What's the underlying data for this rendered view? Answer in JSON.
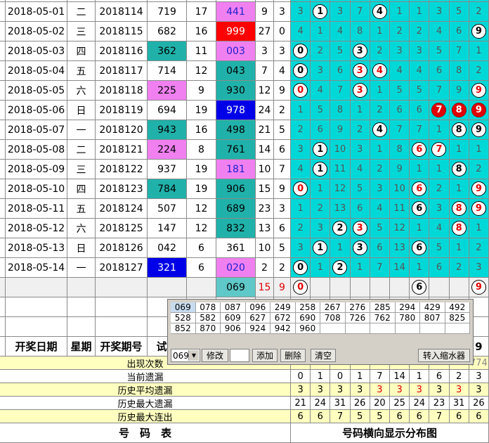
{
  "headers": {
    "date": "开奖日期",
    "weekday": "星期",
    "issue": "开奖期号",
    "number": "试机",
    "last_col_digit": "9"
  },
  "rows": [
    {
      "date": "2018-05-01",
      "weekday": "二",
      "issue": "2018114",
      "trial": "719",
      "c5": "17",
      "prize": "441",
      "sum": "9",
      "span": "3",
      "dist": [
        "3",
        "1",
        "3",
        "7",
        "4",
        "1",
        "1",
        "3",
        "5",
        "2"
      ],
      "balls": [
        1,
        4
      ]
    },
    {
      "date": "2018-05-02",
      "weekday": "三",
      "issue": "2018115",
      "trial": "682",
      "c5": "16",
      "prize": "999",
      "sum": "27",
      "span": "0",
      "dist": [
        "4",
        "1",
        "4",
        "8",
        "1",
        "2",
        "2",
        "4",
        "6",
        "9"
      ],
      "balls": [
        9
      ]
    },
    {
      "date": "2018-05-03",
      "weekday": "四",
      "issue": "2018116",
      "trial": "362",
      "c5": "11",
      "prize": "003",
      "sum": "3",
      "span": "3",
      "dist": [
        "0",
        "2",
        "5",
        "3",
        "2",
        "3",
        "3",
        "5",
        "7",
        "1"
      ],
      "balls": [
        0,
        3
      ]
    },
    {
      "date": "2018-05-04",
      "weekday": "五",
      "issue": "2018117",
      "trial": "714",
      "c5": "12",
      "prize": "043",
      "sum": "7",
      "span": "4",
      "dist": [
        "0",
        "3",
        "6",
        "3",
        "4",
        "4",
        "4",
        "6",
        "8",
        "2"
      ],
      "balls": [
        0,
        3,
        4
      ]
    },
    {
      "date": "2018-05-05",
      "weekday": "六",
      "issue": "2018118",
      "trial": "225",
      "c5": "9",
      "prize": "930",
      "sum": "12",
      "span": "9",
      "dist": [
        "0",
        "4",
        "7",
        "3",
        "1",
        "5",
        "5",
        "7",
        "9",
        "9"
      ],
      "balls": [
        0,
        3,
        9
      ]
    },
    {
      "date": "2018-05-06",
      "weekday": "日",
      "issue": "2018119",
      "trial": "694",
      "c5": "19",
      "prize": "978",
      "sum": "24",
      "span": "2",
      "dist": [
        "1",
        "5",
        "8",
        "1",
        "2",
        "6",
        "6",
        "7",
        "8",
        "9"
      ],
      "balls": [
        7,
        8,
        9
      ]
    },
    {
      "date": "2018-05-07",
      "weekday": "一",
      "issue": "2018120",
      "trial": "943",
      "c5": "16",
      "prize": "498",
      "sum": "21",
      "span": "5",
      "dist": [
        "2",
        "6",
        "9",
        "2",
        "4",
        "7",
        "7",
        "1",
        "8",
        "9"
      ],
      "balls": [
        4,
        8,
        9
      ]
    },
    {
      "date": "2018-05-08",
      "weekday": "二",
      "issue": "2018121",
      "trial": "224",
      "c5": "8",
      "prize": "761",
      "sum": "14",
      "span": "6",
      "dist": [
        "3",
        "1",
        "10",
        "3",
        "1",
        "8",
        "6",
        "7",
        "1",
        "1"
      ],
      "balls": [
        1,
        6,
        7
      ]
    },
    {
      "date": "2018-05-09",
      "weekday": "三",
      "issue": "2018122",
      "trial": "937",
      "c5": "19",
      "prize": "181",
      "sum": "10",
      "span": "7",
      "dist": [
        "4",
        "1",
        "11",
        "4",
        "2",
        "9",
        "1",
        "1",
        "8",
        "2"
      ],
      "balls": [
        1,
        8
      ]
    },
    {
      "date": "2018-05-10",
      "weekday": "四",
      "issue": "2018123",
      "trial": "784",
      "c5": "19",
      "prize": "906",
      "sum": "15",
      "span": "9",
      "dist": [
        "0",
        "1",
        "12",
        "5",
        "3",
        "10",
        "6",
        "2",
        "1",
        "9"
      ],
      "balls": [
        0,
        6,
        9
      ]
    },
    {
      "date": "2018-05-11",
      "weekday": "五",
      "issue": "2018124",
      "trial": "507",
      "c5": "12",
      "prize": "689",
      "sum": "23",
      "span": "3",
      "dist": [
        "1",
        "2",
        "13",
        "6",
        "4",
        "11",
        "6",
        "3",
        "8",
        "9"
      ],
      "balls": [
        6,
        8,
        9
      ]
    },
    {
      "date": "2018-05-12",
      "weekday": "六",
      "issue": "2018125",
      "trial": "147",
      "c5": "12",
      "prize": "832",
      "sum": "13",
      "span": "6",
      "dist": [
        "2",
        "3",
        "2",
        "3",
        "5",
        "12",
        "1",
        "4",
        "8",
        "1"
      ],
      "balls": [
        2,
        3,
        8
      ]
    },
    {
      "date": "2018-05-13",
      "weekday": "日",
      "issue": "2018126",
      "trial": "042",
      "c5": "6",
      "prize": "361",
      "sum": "10",
      "span": "5",
      "dist": [
        "3",
        "1",
        "1",
        "3",
        "6",
        "13",
        "6",
        "5",
        "1",
        "2"
      ],
      "balls": [
        1,
        3,
        6
      ]
    },
    {
      "date": "2018-05-14",
      "weekday": "一",
      "issue": "2018127",
      "trial": "321",
      "c5": "6",
      "prize": "020",
      "sum": "2",
      "span": "2",
      "dist": [
        "0",
        "1",
        "2",
        "1",
        "7",
        "14",
        "1",
        "6",
        "2",
        "3"
      ],
      "balls": [
        0,
        2
      ]
    }
  ],
  "forecast": {
    "prize": "069",
    "sum": "15",
    "span": "9",
    "balls": [
      "0",
      "6",
      "9"
    ]
  },
  "labels": {
    "appear_count": "出现次数",
    "current_miss": "当前遗漏",
    "avg_miss": "历史平均遗漏",
    "max_miss": "历史最大遗漏",
    "max_consec": "历史最大连出",
    "footer_left": "号　码　表",
    "footer_right": "号码横向显示分布图",
    "side_value": "774"
  },
  "stats": {
    "current_miss": [
      "0",
      "1",
      "0",
      "1",
      "7",
      "14",
      "1",
      "6",
      "2",
      "3"
    ],
    "avg_miss": [
      "3",
      "3",
      "3",
      "3",
      "3",
      "3",
      "3",
      "3",
      "3",
      "3"
    ],
    "max_miss": [
      "21",
      "24",
      "31",
      "26",
      "20",
      "25",
      "24",
      "23",
      "31",
      "26"
    ],
    "max_consec": [
      "6",
      "6",
      "7",
      "5",
      "5",
      "6",
      "6",
      "7",
      "6",
      "6"
    ]
  },
  "popup": {
    "numbers": [
      "069",
      "078",
      "087",
      "096",
      "249",
      "258",
      "267",
      "276",
      "285",
      "294",
      "429",
      "492",
      "528",
      "582",
      "609",
      "627",
      "672",
      "690",
      "708",
      "726",
      "762",
      "780",
      "807",
      "825",
      "852",
      "870",
      "906",
      "924",
      "942",
      "960"
    ],
    "select_value": "069",
    "modify": "修改",
    "add": "添加",
    "delete": "删除",
    "clear": "清空",
    "import": "转入缩水器"
  },
  "colors": {
    "dist_bg": "#00d8d8",
    "prize_bg": "#5fc8c8",
    "pink": "#f080f0",
    "red": "#ff0000",
    "blue": "#0000e8",
    "teal": "#20b2aa",
    "header_yellow": "#ffffc0"
  }
}
